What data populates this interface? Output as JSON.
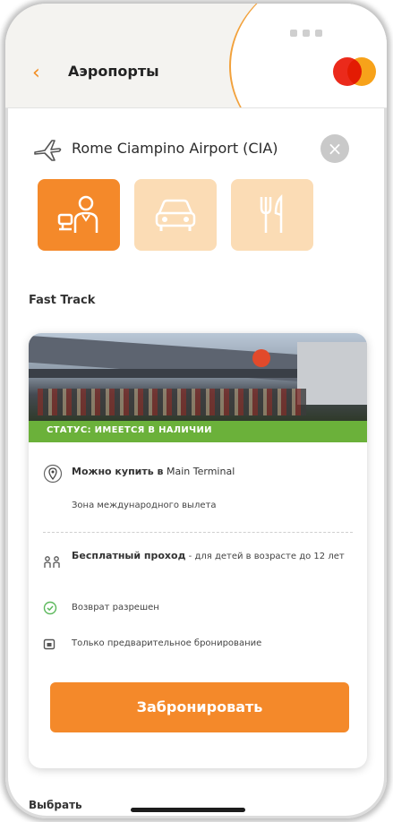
{
  "header": {
    "back_icon": "chevron-left-icon",
    "title": "Аэропорты",
    "card_brand": "mastercard-logo"
  },
  "airport": {
    "icon": "airplane-icon",
    "name": "Rome Ciampino Airport (CIA)",
    "clear_icon": "close-icon"
  },
  "categories": [
    {
      "name": "fast-track-service",
      "icon": "service-staff-icon",
      "selected": true
    },
    {
      "name": "transfer",
      "icon": "car-icon",
      "selected": false
    },
    {
      "name": "restaurants",
      "icon": "fork-knife-icon",
      "selected": false
    }
  ],
  "section_title": "Fast Track",
  "card": {
    "status": "СТАТУС: ИМЕЕТСЯ В НАЛИЧИИ",
    "buy_label": "Можно купить в",
    "buy_location": "Main Terminal",
    "zone": "Зона международного вылета",
    "free_label": "Бесплатный проход",
    "free_rest": " - для детей в возрасте до 12 лет",
    "refund": "Возврат разрешен",
    "prebook": "Только предварительное бронирование",
    "book_button": "Забронировать"
  },
  "bottom_label": "Выбрать",
  "colors": {
    "accent": "#f4892a",
    "accent_light": "#fbdcb5",
    "status_green": "#6bb13a"
  }
}
